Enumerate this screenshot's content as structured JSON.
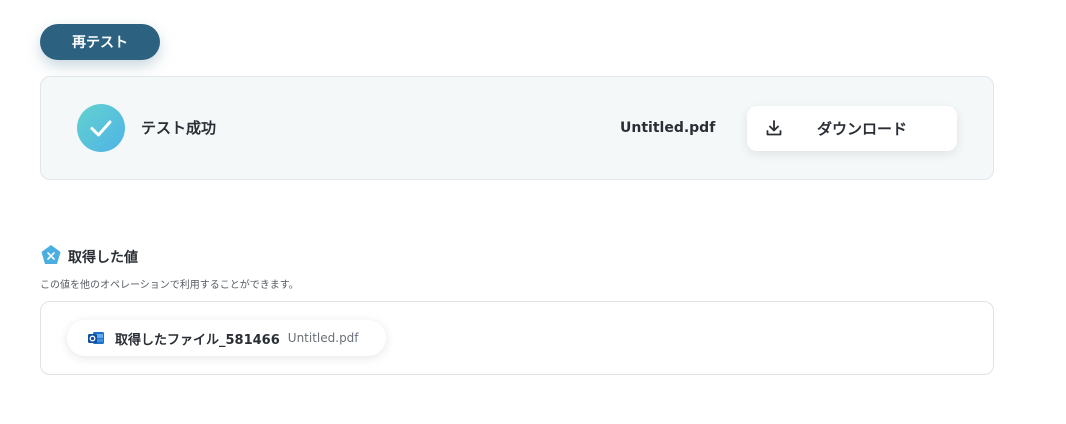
{
  "retest_button": {
    "label": "再テスト"
  },
  "result": {
    "status_text": "テスト成功",
    "file_name": "Untitled.pdf",
    "download_label": "ダウンロード"
  },
  "acquired": {
    "title": "取得した値",
    "description": "この値を他のオペレーションで利用することができます。",
    "items": [
      {
        "label": "取得したファイル_581466",
        "value": "Untitled.pdf",
        "icon": "outlook-icon"
      }
    ]
  },
  "colors": {
    "primary": "#2c6280",
    "success_gradient_start": "#63d2cf",
    "success_gradient_end": "#4fb3e6",
    "card_bg": "#f4f8f9"
  }
}
